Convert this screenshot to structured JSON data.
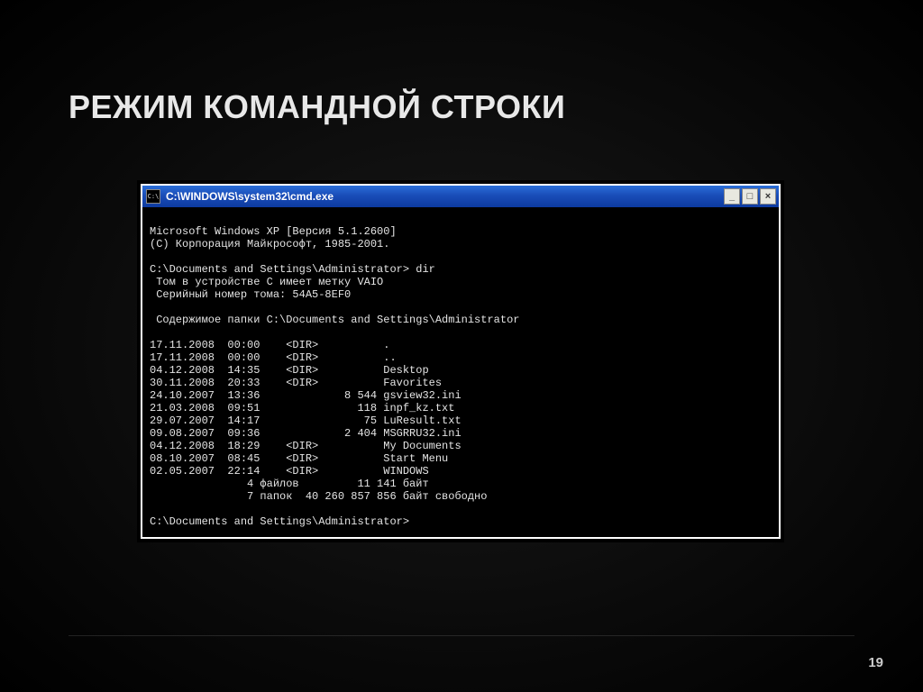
{
  "slide": {
    "title": "РЕЖИМ КОМАНДНОЙ СТРОКИ",
    "number": "19"
  },
  "window": {
    "icon_glyph": "C:\\",
    "title": "C:\\WINDOWS\\system32\\cmd.exe",
    "controls": {
      "min": "_",
      "max": "□",
      "close": "×"
    }
  },
  "terminal": {
    "header1": "Microsoft Windows XP [Версия 5.1.2600]",
    "header2": "(С) Корпорация Майкрософт, 1985-2001.",
    "blank": "",
    "prompt_dir": "C:\\Documents and Settings\\Administrator> dir",
    "vol_label": " Том в устройстве C имеет метку VAIO",
    "vol_serial": " Серийный номер тома: 54A5-8EF0",
    "content_of": " Содержимое папки C:\\Documents and Settings\\Administrator",
    "entries": [
      "17.11.2008  00:00    <DIR>          .",
      "17.11.2008  00:00    <DIR>          ..",
      "04.12.2008  14:35    <DIR>          Desktop",
      "30.11.2008  20:33    <DIR>          Favorites",
      "24.10.2007  13:36             8 544 gsview32.ini",
      "21.03.2008  09:51               118 inpf_kz.txt",
      "29.07.2007  14:17                75 LuResult.txt",
      "09.08.2007  09:36             2 404 MSGRRU32.ini",
      "04.12.2008  18:29    <DIR>          My Documents",
      "08.10.2007  08:45    <DIR>          Start Menu",
      "02.05.2007  22:14    <DIR>          WINDOWS"
    ],
    "summary_files": "               4 файлов         11 141 байт",
    "summary_dirs": "               7 папок  40 260 857 856 байт свободно",
    "prompt_end": "C:\\Documents and Settings\\Administrator>"
  }
}
